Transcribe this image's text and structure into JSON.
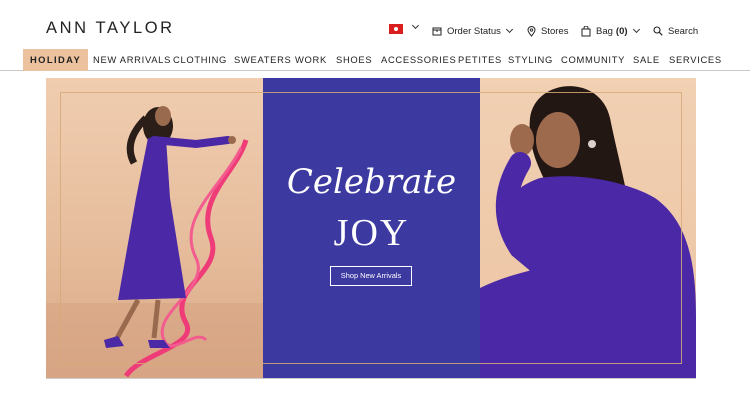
{
  "brand": {
    "logo_text": "ANN TAYLOR"
  },
  "utility": {
    "order_status": "Order Status",
    "stores": "Stores",
    "bag_label": "Bag",
    "bag_count": "(0)",
    "search": "Search"
  },
  "nav": {
    "items": [
      {
        "label": "HOLIDAY"
      },
      {
        "label": "NEW ARRIVALS"
      },
      {
        "label": "CLOTHING"
      },
      {
        "label": "SWEATERS"
      },
      {
        "label": "WORK"
      },
      {
        "label": "SHOES"
      },
      {
        "label": "ACCESSORIES"
      },
      {
        "label": "PETITES"
      },
      {
        "label": "STYLING"
      },
      {
        "label": "COMMUNITY"
      },
      {
        "label": "SALE"
      },
      {
        "label": "SERVICES"
      }
    ]
  },
  "hero": {
    "headline_script": "Celebrate",
    "headline_main": "JOY",
    "cta_label": "Shop New Arrivals"
  },
  "colors": {
    "nav_active": "#ecc19d",
    "hero_panel": "#3c39a0",
    "dress": "#4a28a6",
    "ribbon": "#ef3b78"
  }
}
